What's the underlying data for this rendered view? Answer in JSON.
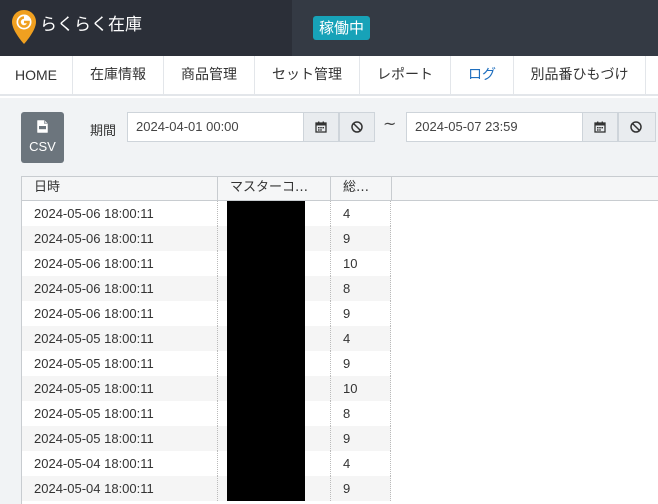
{
  "header": {
    "app_title": "らくらく在庫",
    "status_badge": "稼働中",
    "logo_icon": "location-pin-logo-icon",
    "logo_color": "#f0a020"
  },
  "nav": {
    "items": [
      {
        "label": "HOME",
        "active": false
      },
      {
        "label": "在庫情報",
        "active": false
      },
      {
        "label": "商品管理",
        "active": false
      },
      {
        "label": "セット管理",
        "active": false
      },
      {
        "label": "レポート",
        "active": false
      },
      {
        "label": "ログ",
        "active": true
      },
      {
        "label": "別品番ひもづけ",
        "active": false
      }
    ]
  },
  "toolbar": {
    "csv_label": "CSV",
    "period_label": "期間",
    "date_from": "2024-04-01 00:00",
    "date_to": "2024-05-07 23:59",
    "range_separator": "~",
    "calendar_icon": "calendar-icon",
    "clear_icon": "clear-icon"
  },
  "table": {
    "columns": [
      "日時",
      "マスターコ…",
      "総…"
    ],
    "rows": [
      {
        "datetime": "2024-05-06 18:00:11",
        "master_code": "",
        "total": "4"
      },
      {
        "datetime": "2024-05-06 18:00:11",
        "master_code": "",
        "total": "9"
      },
      {
        "datetime": "2024-05-06 18:00:11",
        "master_code": "",
        "total": "10"
      },
      {
        "datetime": "2024-05-06 18:00:11",
        "master_code": "",
        "total": "8"
      },
      {
        "datetime": "2024-05-06 18:00:11",
        "master_code": "",
        "total": "9"
      },
      {
        "datetime": "2024-05-05 18:00:11",
        "master_code": "",
        "total": "4"
      },
      {
        "datetime": "2024-05-05 18:00:11",
        "master_code": "",
        "total": "9"
      },
      {
        "datetime": "2024-05-05 18:00:11",
        "master_code": "",
        "total": "10"
      },
      {
        "datetime": "2024-05-05 18:00:11",
        "master_code": "",
        "total": "8"
      },
      {
        "datetime": "2024-05-05 18:00:11",
        "master_code": "",
        "total": "9"
      },
      {
        "datetime": "2024-05-04 18:00:11",
        "master_code": "",
        "total": "4"
      },
      {
        "datetime": "2024-05-04 18:00:11",
        "master_code": "",
        "total": "9"
      }
    ]
  },
  "colors": {
    "header_bg": "#2b2f38",
    "badge_bg": "#17a2b8",
    "active_tab": "#1f6fbf",
    "csv_button_bg": "#6c757d",
    "redaction": "#000000"
  }
}
